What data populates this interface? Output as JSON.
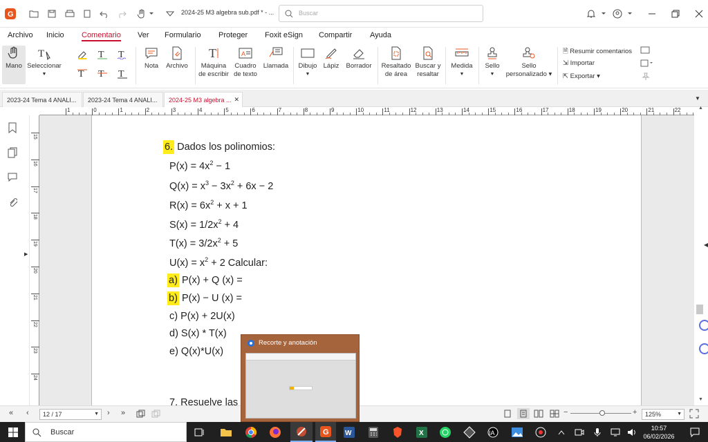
{
  "titlebar": {
    "doc_title": "2024-25 M3 algebra sub.pdf * - ...",
    "search_placeholder": "Buscar"
  },
  "menu": [
    "Archivo",
    "Inicio",
    "Comentario",
    "Ver",
    "Formulario",
    "Proteger",
    "Foxit eSign",
    "Compartir",
    "Ayuda"
  ],
  "ribbon": {
    "mano": "Mano",
    "seleccionar": "Seleccionar",
    "nota": "Nota",
    "archivo": "Archivo",
    "maquina1": "Máquina",
    "maquina2": "de escribir",
    "cuadro1": "Cuadro",
    "cuadro2": "de texto",
    "llamada": "Llamada",
    "dibujo": "Dibujo",
    "lapiz": "Lápiz",
    "borrador": "Borrador",
    "resaltado1": "Resaltado",
    "resaltado2": "de área",
    "buscar1": "Buscar y",
    "buscar2": "resaltar",
    "medida": "Medida",
    "sello": "Sello",
    "sello_p1": "Sello",
    "sello_p2": "personalizado",
    "resumir": "Resumir comentarios",
    "importar": "Importar",
    "exportar": "Exportar"
  },
  "tabs": [
    "2023-24 Tema 4 ANALI...",
    "2023-24 Tema 4 ANALI...",
    "2024-25 M3 algebra ..."
  ],
  "ruler_numbers": [
    "1",
    "0",
    "1",
    "2",
    "3",
    "4",
    "5",
    "6",
    "7",
    "8",
    "9",
    "10",
    "11",
    "12",
    "13",
    "14",
    "15",
    "16",
    "17",
    "18",
    "19",
    "20",
    "21",
    "22"
  ],
  "vruler_numbers": [
    "15",
    "16",
    "17",
    "18",
    "19",
    "20",
    "21",
    "22",
    "23",
    "24"
  ],
  "document": {
    "q_num": "6.",
    "q_text": "Dados los polinomios:",
    "p": [
      "P(x) = 4x",
      "2",
      " − 1"
    ],
    "q": [
      "Q(x) = x",
      "3",
      " − 3x",
      "2",
      " + 6x − 2"
    ],
    "r": [
      "R(x) = 6x",
      "2",
      " + x + 1"
    ],
    "s": [
      "S(x) = 1/2x",
      "2",
      " + 4"
    ],
    "t": [
      "T(x) = 3/2x",
      "2",
      " + 5"
    ],
    "u": [
      "U(x) = x",
      "2",
      " + 2 Calcular:"
    ],
    "a_label": "a)",
    "a_text": "P(x) + Q (x) =",
    "b_label": "b)",
    "b_text": "P(x) − U (x) =",
    "c_text": "c)  P(x) + 2U(x)",
    "d_text": "d)  S(x) * T(x)",
    "e_text": "e)  Q(x)*U(x)",
    "next": "7. Resuelve las"
  },
  "status": {
    "page": "12 / 17",
    "zoom": "125%"
  },
  "popup": {
    "title": "Recorte y anotación"
  },
  "taskbar": {
    "search": "Buscar",
    "time": "10:57",
    "date": "06/02/2026"
  },
  "colors": {
    "accent": "#c8102e",
    "highlight": "#ffec1a",
    "popup": "#a5643c",
    "taskbar": "#202020"
  }
}
